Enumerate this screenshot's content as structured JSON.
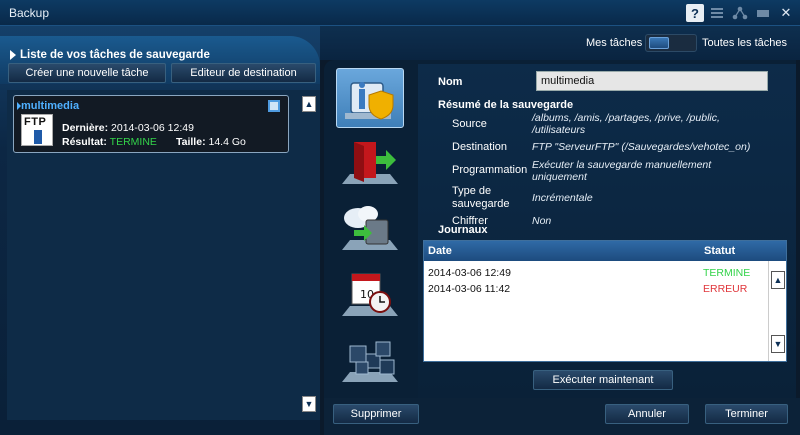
{
  "window": {
    "title": "Backup"
  },
  "titlebar": {
    "help": "?",
    "close": "✕"
  },
  "left": {
    "header": "Liste de vos tâches de sauvegarde",
    "new_task_button": "Créer une nouvelle tâche",
    "dest_editor_button": "Editeur de destination",
    "task": {
      "name": "multimedia",
      "icon_label": "FTP",
      "last_label": "Dernière:",
      "last_value": "2014-03-06 12:49",
      "result_label": "Résultat:",
      "result_value": "TERMINE",
      "size_label": "Taille:",
      "size_value": "14.4 Go"
    }
  },
  "toggle": {
    "left_label": "Mes tâches",
    "right_label": "Toutes les tâches"
  },
  "detail": {
    "name_label": "Nom",
    "name_value": "multimedia",
    "summary_title": "Résumé de la sauvegarde",
    "source_label": "Source",
    "source_value_1": "/albums, /amis, /partages, /prive, /public,",
    "source_value_2": "/utilisateurs",
    "dest_label": "Destination",
    "dest_value": "FTP \"ServeurFTP\" (/Sauvegardes/vehotec_on)",
    "prog_label": "Programmation",
    "prog_value_1": "Exécuter la sauvegarde manuellement",
    "prog_value_2": "uniquement",
    "type_label_1": "Type de",
    "type_label_2": "sauvegarde",
    "type_value": "Incrémentale",
    "encrypt_label": "Chiffrer",
    "encrypt_value": "Non"
  },
  "journal": {
    "title": "Journaux",
    "col_date": "Date",
    "col_status": "Statut",
    "rows": [
      {
        "date": "2014-03-06 12:49",
        "status": "TERMINE",
        "status_color": "#33d34a"
      },
      {
        "date": "2014-03-06 11:42",
        "status": "ERREUR",
        "status_color": "#e0363b"
      }
    ]
  },
  "run_now_button": "Exécuter maintenant",
  "bottom": {
    "delete_button": "Supprimer",
    "cancel_button": "Annuler",
    "finish_button": "Terminer"
  }
}
